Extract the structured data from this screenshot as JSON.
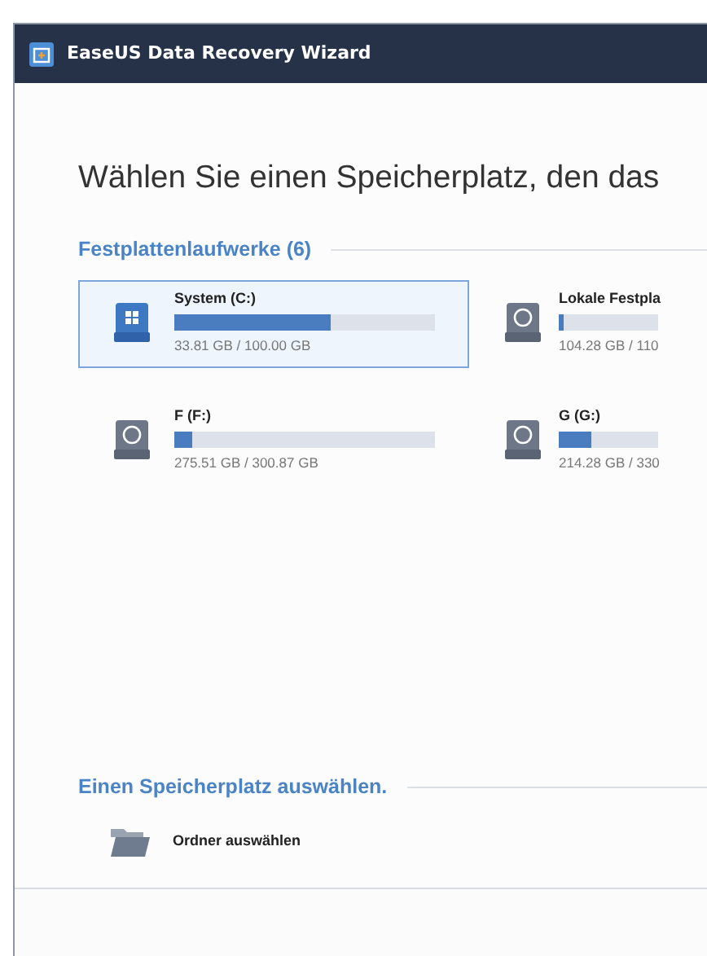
{
  "window": {
    "title": "EaseUS Data Recovery Wizard"
  },
  "heading": "Wählen Sie einen Speicherplatz, den das",
  "drives_section": {
    "title": "Festplattenlaufwerke (6)"
  },
  "drives": [
    {
      "name": "System (C:)",
      "kind": "system",
      "selected": true,
      "level": 0.6,
      "size": "33.81 GB / 100.00 GB"
    },
    {
      "name": "Lokale Festpla",
      "kind": "disk",
      "selected": false,
      "level": 0.05,
      "size": "104.28 GB / 110"
    },
    {
      "name": "F (F:)",
      "kind": "disk",
      "selected": false,
      "level": 0.07,
      "size": "275.51 GB / 300.87 GB"
    },
    {
      "name": "G (G:)",
      "kind": "disk",
      "selected": false,
      "level": 0.32,
      "size": "214.28 GB / 330"
    }
  ],
  "location_section": {
    "title": "Einen Speicherplatz auswählen."
  },
  "locations": [
    {
      "label": "Ordner auswählen"
    }
  ]
}
